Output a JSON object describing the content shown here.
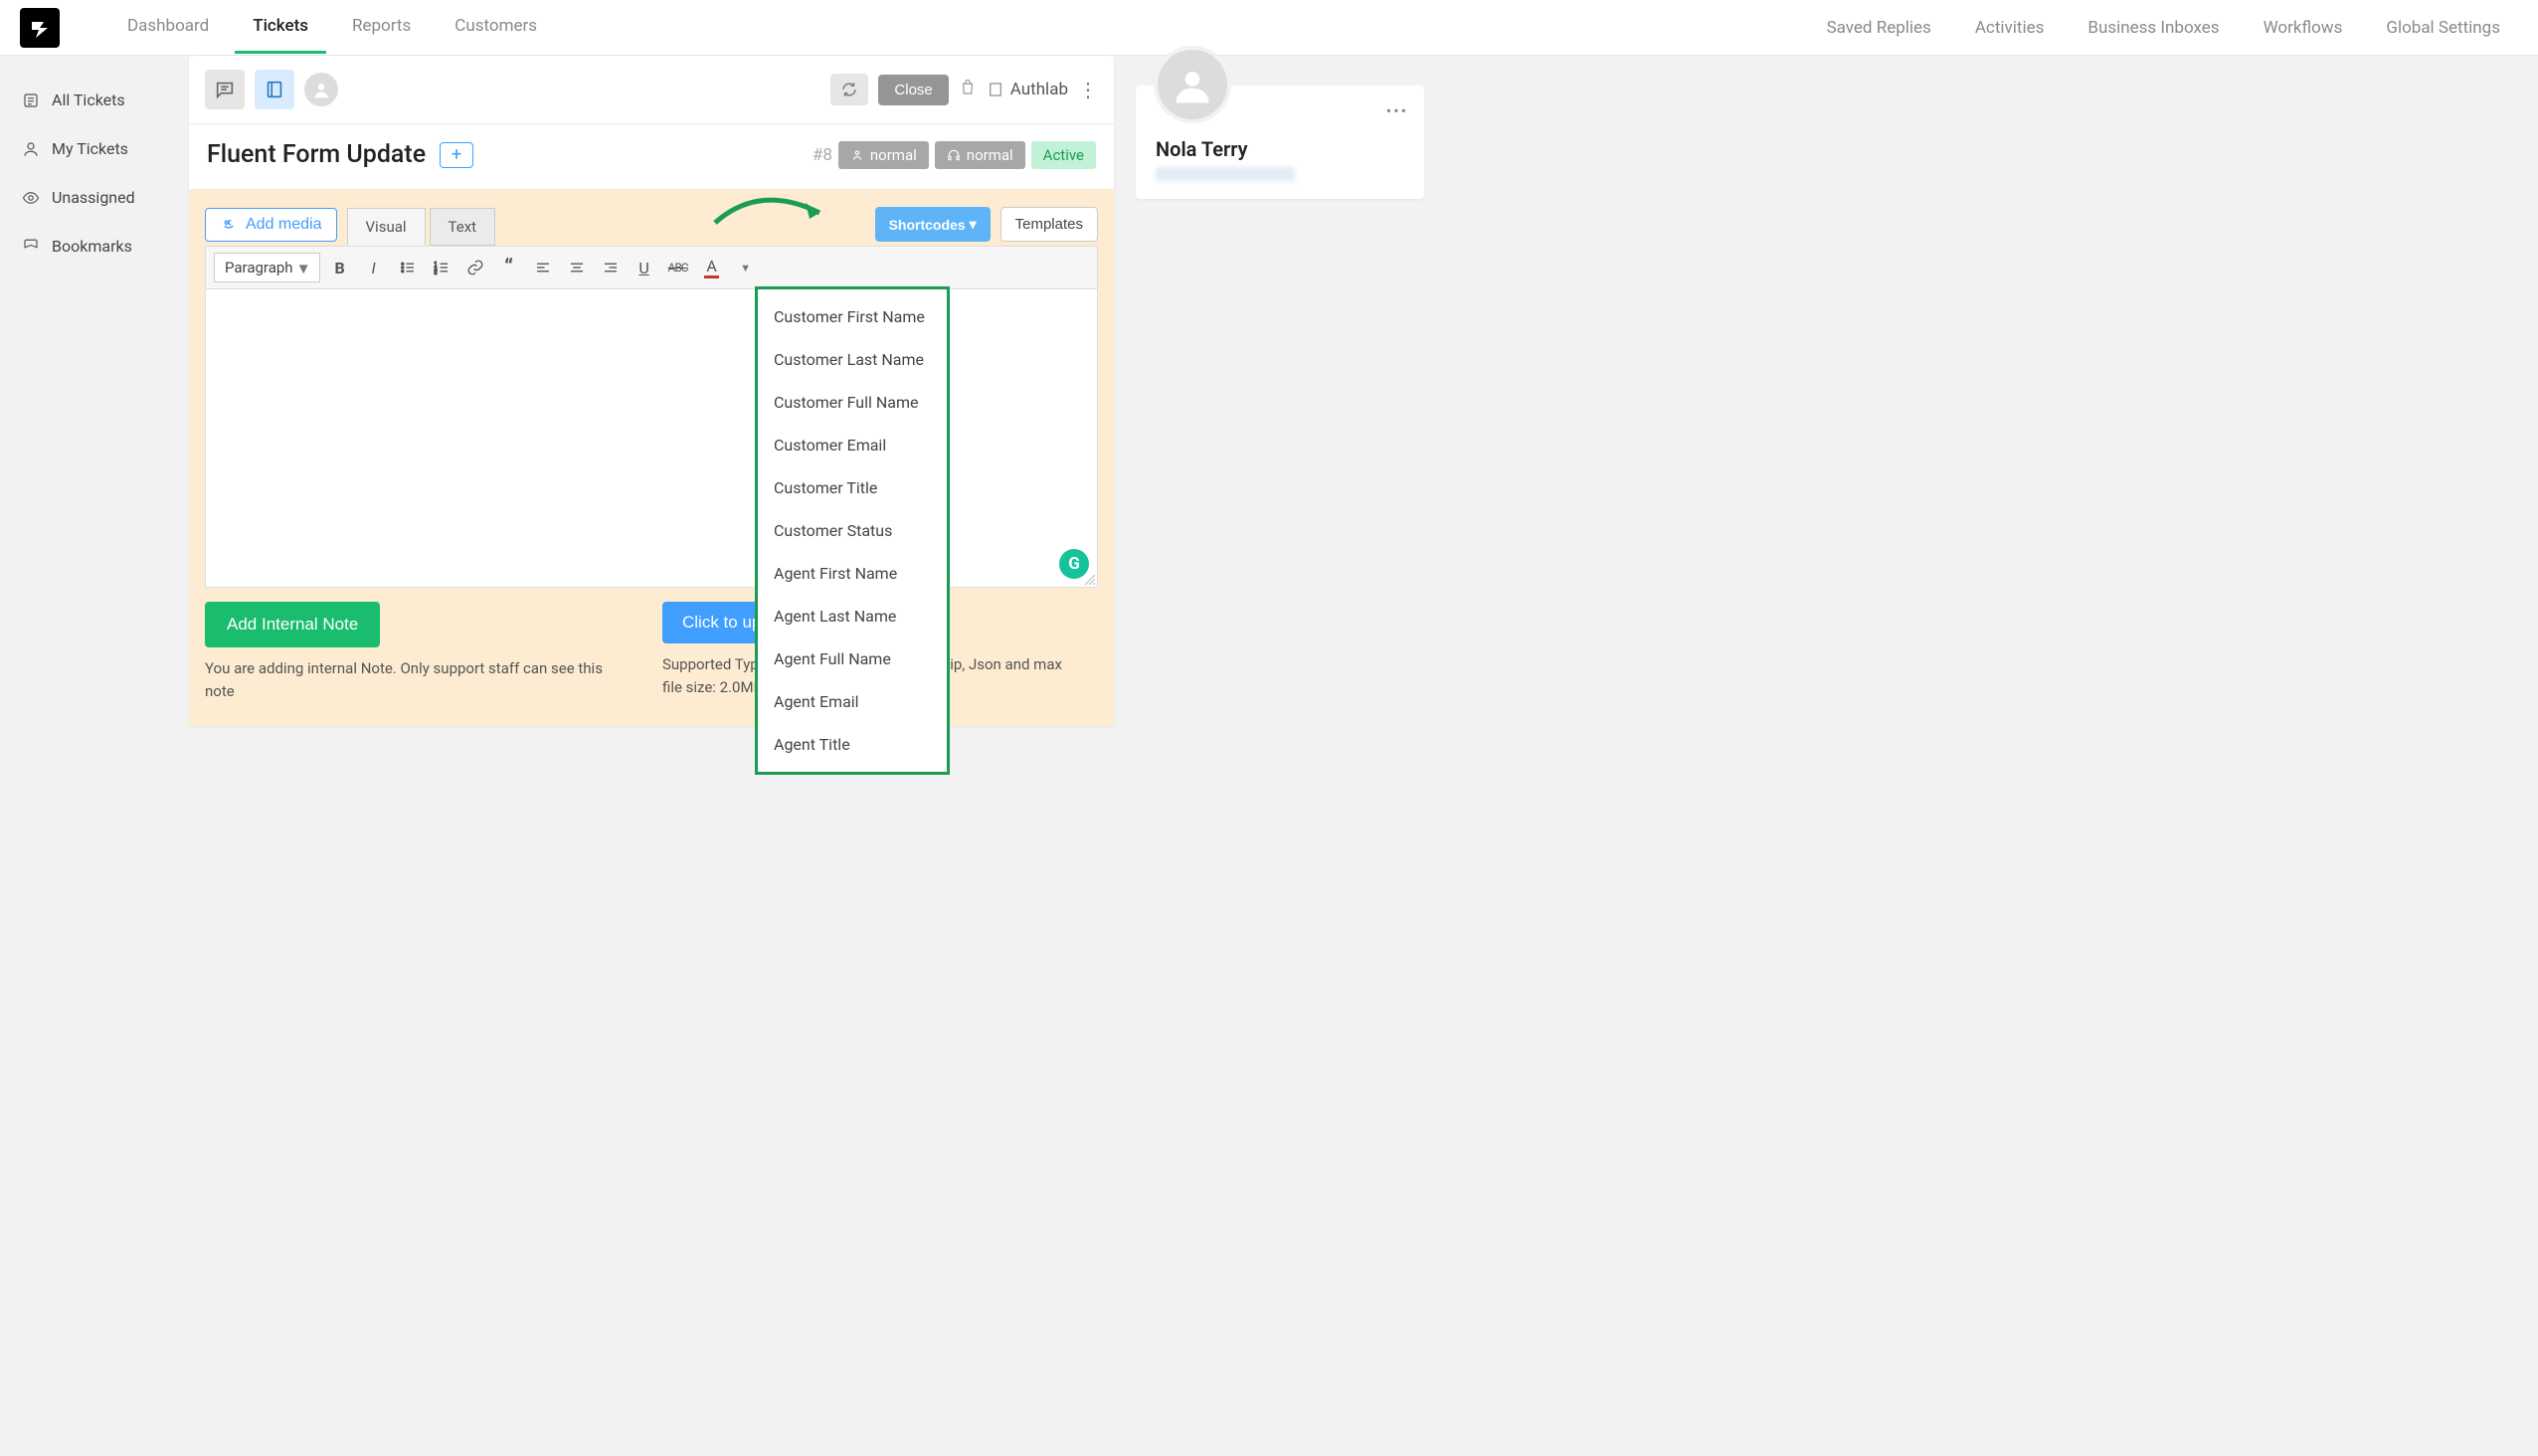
{
  "nav": {
    "left": [
      "Dashboard",
      "Tickets",
      "Reports",
      "Customers"
    ],
    "active": "Tickets",
    "right": [
      "Saved Replies",
      "Activities",
      "Business Inboxes",
      "Workflows",
      "Global Settings"
    ]
  },
  "sidebar": {
    "items": [
      {
        "label": "All Tickets",
        "icon": "list"
      },
      {
        "label": "My Tickets",
        "icon": "user"
      },
      {
        "label": "Unassigned",
        "icon": "eye"
      },
      {
        "label": "Bookmarks",
        "icon": "bookmark"
      }
    ]
  },
  "ticket": {
    "title": "Fluent Form Update",
    "id": "#8",
    "priority": "normal",
    "channel": "normal",
    "status": "Active",
    "close_label": "Close",
    "business": "Authlab"
  },
  "editor": {
    "add_media": "Add media",
    "tab_visual": "Visual",
    "tab_text": "Text",
    "shortcodes_label": "Shortcodes",
    "templates_label": "Templates",
    "paragraph": "Paragraph",
    "dropdown": [
      "Customer First Name",
      "Customer Last Name",
      "Customer Full Name",
      "Customer Email",
      "Customer Title",
      "Customer Status",
      "Agent First Name",
      "Agent Last Name",
      "Agent Full Name",
      "Agent Email",
      "Agent Title"
    ]
  },
  "actions": {
    "add_note": "Add Internal Note",
    "note_help": "You are adding internal Note. Only support staff can see this note",
    "upload": "Click to upload",
    "upload_help": "Supported Types: Photos, CSV, PDF, Docs, Zip, Json and max file size: 2.0MB"
  },
  "customer": {
    "name": "Nola Terry"
  }
}
